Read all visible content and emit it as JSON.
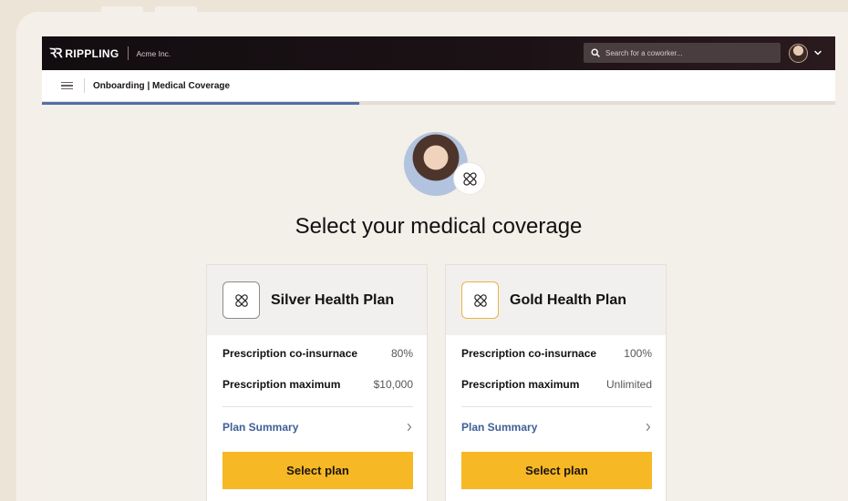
{
  "app": {
    "brand": "RIPPLING",
    "logo_mark": "ꝚꝚ",
    "company": "Acme Inc."
  },
  "search": {
    "placeholder": "Search for a coworker..."
  },
  "breadcrumb": "Onboarding | Medical Coverage",
  "progress": {
    "fraction": 0.4
  },
  "heading": "Select your medical coverage",
  "plans": [
    {
      "name": "Silver Health Plan",
      "accent": "#8f8a88",
      "rows": [
        {
          "label": "Prescription co-insurnace",
          "value": "80%"
        },
        {
          "label": "Prescription maximum",
          "value": "$10,000"
        }
      ],
      "summary_label": "Plan Summary",
      "button_label": "Select plan"
    },
    {
      "name": "Gold Health Plan",
      "accent": "#e9b53f",
      "rows": [
        {
          "label": "Prescription co-insurnace",
          "value": "100%"
        },
        {
          "label": "Prescription maximum",
          "value": "Unlimited"
        }
      ],
      "summary_label": "Plan Summary",
      "button_label": "Select plan"
    }
  ],
  "colors": {
    "topbar": "#120d10",
    "accent_blue": "#5270a7",
    "button_yellow": "#f6b824",
    "page_bg": "#f3efe9"
  },
  "icons": {
    "search": "search-icon",
    "menu": "hamburger-icon",
    "plan": "medical-plan-icon",
    "chevron_down": "chevron-down-icon",
    "chevron_right": "chevron-right-icon"
  }
}
